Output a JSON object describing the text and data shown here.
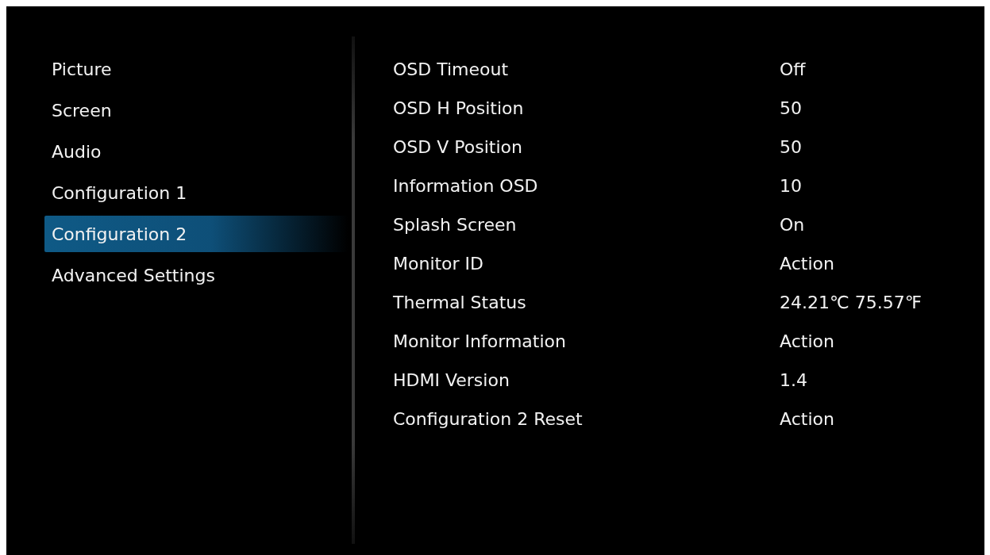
{
  "menu": [
    {
      "label": "Picture",
      "selected": false
    },
    {
      "label": "Screen",
      "selected": false
    },
    {
      "label": "Audio",
      "selected": false
    },
    {
      "label": "Configuration 1",
      "selected": false
    },
    {
      "label": "Configuration 2",
      "selected": true
    },
    {
      "label": "Advanced Settings",
      "selected": false
    }
  ],
  "settings": [
    {
      "label": "OSD Timeout",
      "value": "Off"
    },
    {
      "label": "OSD H Position",
      "value": "50"
    },
    {
      "label": "OSD V Position",
      "value": "50"
    },
    {
      "label": "Information OSD",
      "value": "10"
    },
    {
      "label": "Splash Screen",
      "value": "On"
    },
    {
      "label": "Monitor ID",
      "value": "Action"
    },
    {
      "label": "Thermal Status",
      "value": "24.21℃ 75.57℉"
    },
    {
      "label": "Monitor Information",
      "value": "Action"
    },
    {
      "label": "HDMI Version",
      "value": "1.4"
    },
    {
      "label": "Configuration 2 Reset",
      "value": "Action"
    }
  ]
}
